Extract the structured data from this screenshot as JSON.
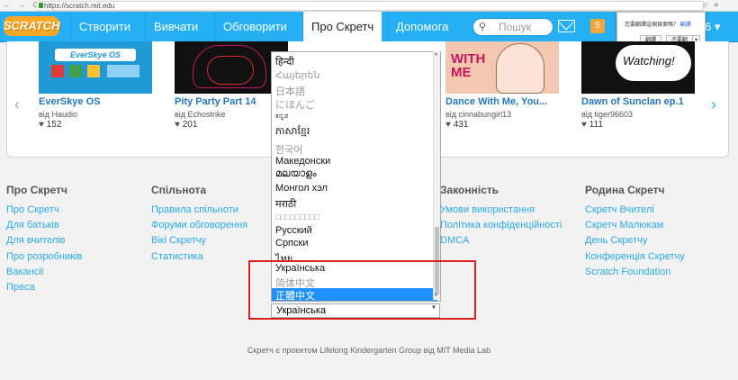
{
  "browser": {
    "url": "https://scratch.mit.edu",
    "nav_glyphs": "← → C"
  },
  "nav": {
    "logo": "SCRATCH",
    "items": [
      "Створити",
      "Вивчати",
      "Обговорити",
      "Про Скретч",
      "Допомога"
    ],
    "active_index": 3,
    "search_placeholder": "Пошук",
    "user_number": "6"
  },
  "translate_popup": {
    "question": "您要翻譯這個頁面嗎？",
    "link": "翻譯",
    "btn_translate": "翻譯",
    "btn_never": "不要翻",
    "btn_more": "▾"
  },
  "projects": [
    {
      "title": "EverSkye OS",
      "by": "від Haudio",
      "likes": "152",
      "thumb_color": "#1f9ad6",
      "thumb_text": "EverSkye OS"
    },
    {
      "title": "Pity Party Part 14",
      "by": "від Echostrike",
      "likes": "201",
      "thumb_color": "#111111"
    },
    {
      "title": "Dance With Me, You...",
      "by": "від cinnabungirl13",
      "likes": "431",
      "thumb_color": "#f4c8b0",
      "thumb_text": "WITH ME"
    },
    {
      "title": "Dawn of Sunclan ep.1",
      "by": "від tiger96603",
      "likes": "111",
      "thumb_color": "#111111",
      "thumb_text": "Watching!"
    }
  ],
  "languages": [
    {
      "name": "हिन्दी",
      "dim": false
    },
    {
      "name": "Հայերեն",
      "dim": true
    },
    {
      "name": "日本語",
      "dim": true
    },
    {
      "name": "にほんご",
      "dim": true
    },
    {
      "name": "ಕನ್ನಡ",
      "dim": false
    },
    {
      "name": "ភាសាខ្មែរ",
      "dim": false
    },
    {
      "name": "한국어",
      "dim": true
    },
    {
      "name": "Македонски",
      "dim": false
    },
    {
      "name": "മലയാളം",
      "dim": false
    },
    {
      "name": "Монгол хэл",
      "dim": false
    },
    {
      "name": "मराठी",
      "dim": false
    },
    {
      "name": "□□□□□□□□□",
      "dim": true
    },
    {
      "name": "Русский",
      "dim": false
    },
    {
      "name": "Српски",
      "dim": false
    },
    {
      "name": "ไทย",
      "dim": false
    },
    {
      "name": "Українська",
      "dim": false
    },
    {
      "name": "简体中文",
      "dim": true
    },
    {
      "name": "正體中文",
      "dim": false,
      "selected": true
    }
  ],
  "select_value": "Українська",
  "footer": {
    "columns": [
      {
        "heading": "Про Скретч",
        "links": [
          "Про Скретч",
          "Для батьків",
          "Для вчителів",
          "Про розробників",
          "Вакансії",
          "Преса"
        ]
      },
      {
        "heading": "Спільнота",
        "links": [
          "Правила спільноти",
          "Форуми обговорення",
          "Вікі Скретчу",
          "Статистика"
        ]
      },
      {
        "heading": "Законність",
        "links": [
          "Умови використання",
          "Політика конфіденційності",
          "DMCA"
        ]
      },
      {
        "heading": "Родина Скретч",
        "links": [
          "Скретч Вчителі",
          "Скретч Малюкам",
          "День Скретчу",
          "Конференція Скретчу",
          "Scratch Foundation"
        ]
      }
    ],
    "credit": "Скретч є проектом Lifelong Kindergarten Group від MIT Media Lab"
  }
}
